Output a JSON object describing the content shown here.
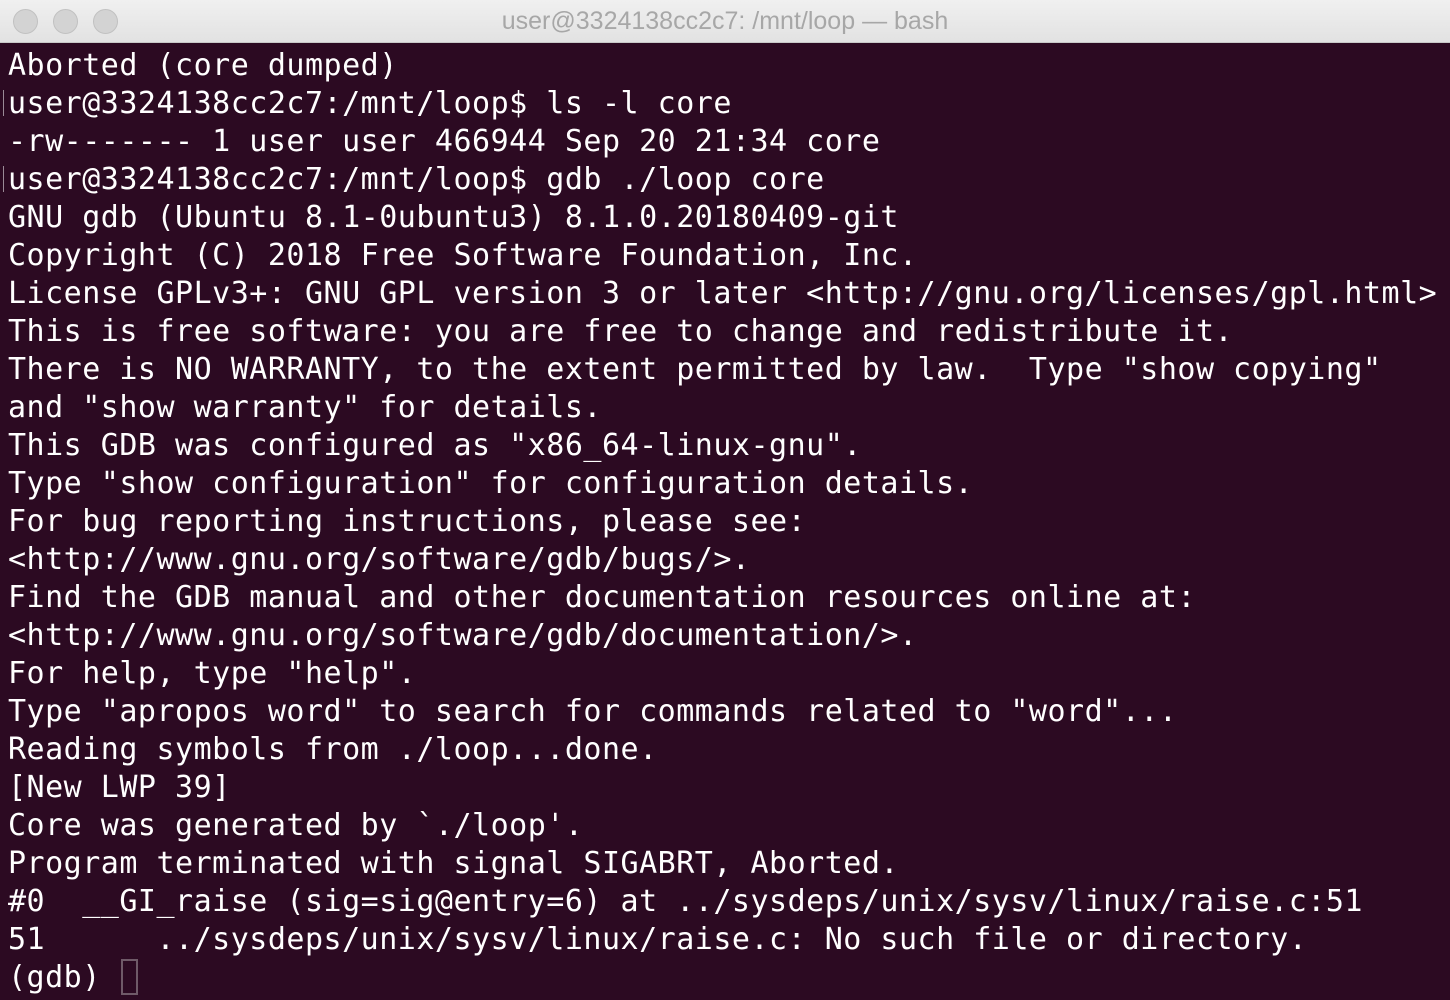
{
  "window": {
    "title": "user@3324138cc2c7: /mnt/loop — bash"
  },
  "terminal": {
    "lines": [
      {
        "text": "Aborted (core dumped)",
        "prompt": false
      },
      {
        "text": "user@3324138cc2c7:/mnt/loop$ ls -l core",
        "prompt": true
      },
      {
        "text": "-rw------- 1 user user 466944 Sep 20 21:34 core",
        "prompt": false
      },
      {
        "text": "user@3324138cc2c7:/mnt/loop$ gdb ./loop core",
        "prompt": true
      },
      {
        "text": "GNU gdb (Ubuntu 8.1-0ubuntu3) 8.1.0.20180409-git",
        "prompt": false
      },
      {
        "text": "Copyright (C) 2018 Free Software Foundation, Inc.",
        "prompt": false
      },
      {
        "text": "License GPLv3+: GNU GPL version 3 or later <http://gnu.org/licenses/gpl.html>",
        "prompt": false
      },
      {
        "text": "This is free software: you are free to change and redistribute it.",
        "prompt": false
      },
      {
        "text": "There is NO WARRANTY, to the extent permitted by law.  Type \"show copying\"",
        "prompt": false
      },
      {
        "text": "and \"show warranty\" for details.",
        "prompt": false
      },
      {
        "text": "This GDB was configured as \"x86_64-linux-gnu\".",
        "prompt": false
      },
      {
        "text": "Type \"show configuration\" for configuration details.",
        "prompt": false
      },
      {
        "text": "For bug reporting instructions, please see:",
        "prompt": false
      },
      {
        "text": "<http://www.gnu.org/software/gdb/bugs/>.",
        "prompt": false
      },
      {
        "text": "Find the GDB manual and other documentation resources online at:",
        "prompt": false
      },
      {
        "text": "<http://www.gnu.org/software/gdb/documentation/>.",
        "prompt": false
      },
      {
        "text": "For help, type \"help\".",
        "prompt": false
      },
      {
        "text": "Type \"apropos word\" to search for commands related to \"word\"...",
        "prompt": false
      },
      {
        "text": "Reading symbols from ./loop...done.",
        "prompt": false
      },
      {
        "text": "[New LWP 39]",
        "prompt": false
      },
      {
        "text": "Core was generated by `./loop'.",
        "prompt": false
      },
      {
        "text": "Program terminated with signal SIGABRT, Aborted.",
        "prompt": false
      },
      {
        "text": "#0  __GI_raise (sig=sig@entry=6) at ../sysdeps/unix/sysv/linux/raise.c:51",
        "prompt": false
      },
      {
        "text": "51\t../sysdeps/unix/sysv/linux/raise.c: No such file or directory.",
        "prompt": false
      }
    ],
    "current_prompt": "(gdb) "
  },
  "colors": {
    "background": "#2c0a22",
    "foreground": "#ffffff"
  }
}
